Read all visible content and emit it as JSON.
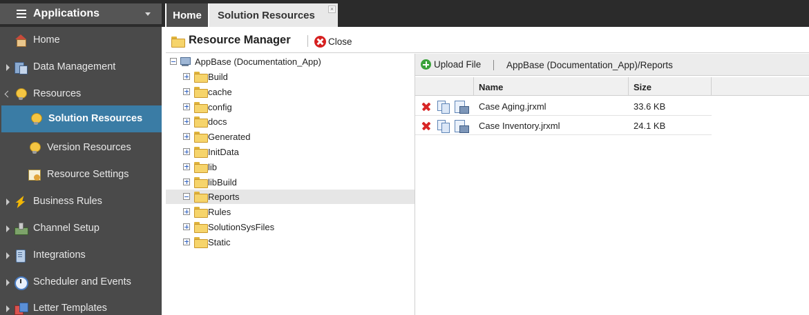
{
  "sidebar": {
    "title": "Applications",
    "items": [
      {
        "label": "Home",
        "icon": "home-icon"
      },
      {
        "label": "Data Management",
        "icon": "data-management-icon"
      },
      {
        "label": "Resources",
        "icon": "resources-icon"
      },
      {
        "label": "Solution Resources",
        "icon": "lightbulb-icon"
      },
      {
        "label": "Version Resources",
        "icon": "lightbulb-icon"
      },
      {
        "label": "Resource Settings",
        "icon": "settings-doc-icon"
      },
      {
        "label": "Business Rules",
        "icon": "lightning-icon"
      },
      {
        "label": "Channel Setup",
        "icon": "channel-icon"
      },
      {
        "label": "Integrations",
        "icon": "integrations-icon"
      },
      {
        "label": "Scheduler and Events",
        "icon": "clock-icon"
      },
      {
        "label": "Letter Templates",
        "icon": "letter-templates-icon"
      }
    ]
  },
  "tabs": {
    "home": "Home",
    "solution_resources": "Solution Resources",
    "close_glyph": "×"
  },
  "panel": {
    "title": "Resource Manager",
    "close_label": "Close"
  },
  "tree": {
    "root": "AppBase (Documentation_App)",
    "folders": [
      "Build",
      "cache",
      "config",
      "docs",
      "Generated",
      "InitData",
      "lib",
      "libBuild",
      "Reports",
      "Rules",
      "SolutionSysFiles",
      "Static"
    ],
    "selected": "Reports"
  },
  "files": {
    "upload_label": "Upload File",
    "path": "AppBase (Documentation_App)/Reports",
    "columns": {
      "name": "Name",
      "size": "Size"
    },
    "rows": [
      {
        "name": "Case Aging.jrxml",
        "size": "33.6 KB"
      },
      {
        "name": "Case Inventory.jrxml",
        "size": "24.1 KB"
      }
    ]
  },
  "colors": {
    "sidebar_bg": "#4a4a4a",
    "sidebar_active": "#3a7ca5",
    "header_dark": "#2b2b2b",
    "delete_red": "#d82626",
    "upload_green": "#3aa23a"
  }
}
